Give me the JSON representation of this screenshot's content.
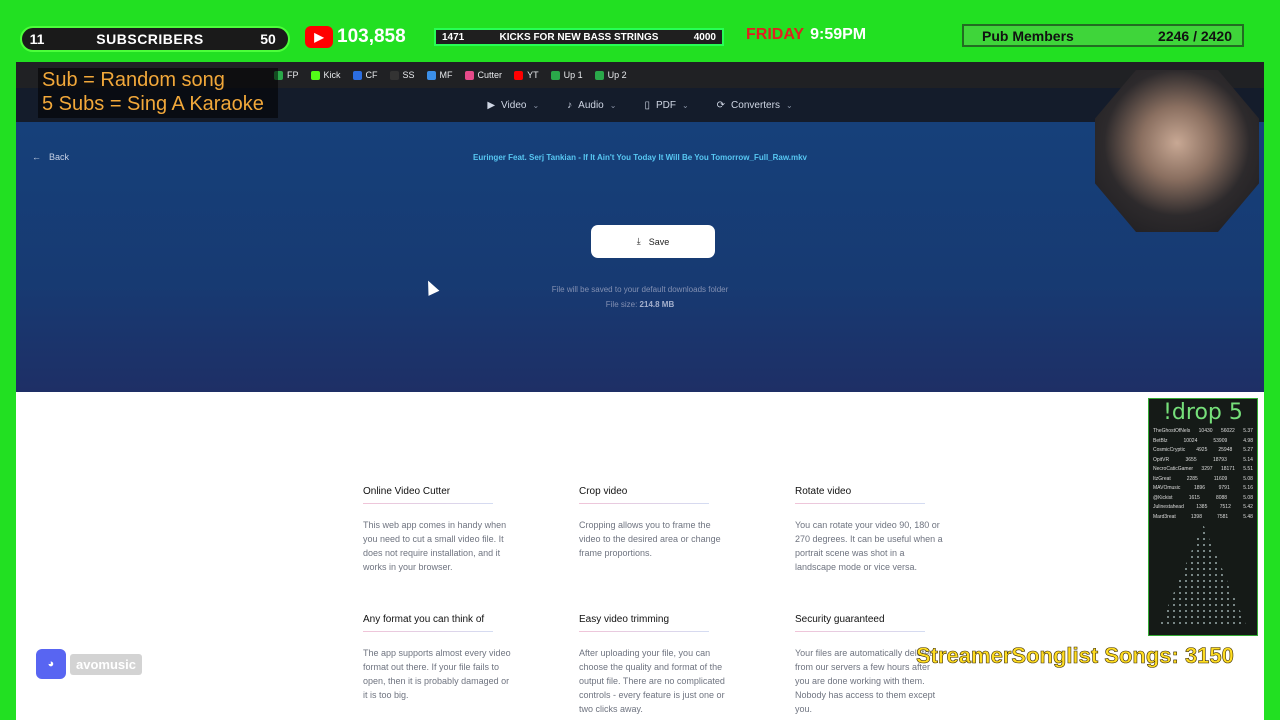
{
  "overlay": {
    "sub_count_left": "11",
    "sub_label": "SUBSCRIBERS",
    "sub_count_right": "50",
    "yt_count": "103,858",
    "kicks_left": "1471",
    "kicks_label": "KICKS FOR NEW BASS STRINGS",
    "kicks_right": "4000",
    "clock_day": "FRIDAY",
    "clock_time": "9:59PM",
    "pub_label": "Pub Members",
    "pub_value": "2246 / 2420",
    "tagline_1": "Sub = Random song",
    "tagline_2": "5 Subs = Sing A Karaoke",
    "drop_title": "!drop 5",
    "drop_rows": [
      [
        "TheGhostOfNels",
        "10430",
        "56022",
        "5.37"
      ],
      [
        "BetBlz",
        "10024",
        "53909",
        "4.98"
      ],
      [
        "CosmicCryptic",
        "4925",
        "25948",
        "5.27"
      ],
      [
        "OpitVR",
        "3655",
        "18793",
        "5.14"
      ],
      [
        "NecroCaticGamer",
        "3297",
        "18171",
        "5.51"
      ],
      [
        "ItzGreat",
        "2285",
        "11609",
        "5.08"
      ],
      [
        "MAVOmusic",
        "1896",
        "9791",
        "5.16"
      ],
      [
        "@Kickist",
        "1615",
        "8088",
        "5.08"
      ],
      [
        "Julinestahead",
        "1385",
        "7512",
        "5.42"
      ],
      [
        "Mard3reat",
        "1398",
        "7581",
        "5.48"
      ]
    ],
    "songlist": "StreamerSonglist Songs: 3150",
    "discord_name": "avomusic"
  },
  "bookmarks": [
    "FP",
    "Kick",
    "CF",
    "SS",
    "MF",
    "Cutter",
    "YT",
    "Up 1",
    "Up 2"
  ],
  "nav": {
    "items": [
      "Video",
      "Audio",
      "PDF",
      "Converters"
    ]
  },
  "hero": {
    "back_label": "Back",
    "filename": "Euringer Feat. Serj Tankian - If It Ain't You Today It Will Be You Tomorrow_Full_Raw.mkv",
    "save_label": "Save",
    "save_note": "File will be saved to your default downloads folder",
    "filesize_label": "File size:",
    "filesize_value": "214.8 MB"
  },
  "features": [
    {
      "title": "Online Video Cutter",
      "text": "This web app comes in handy when you need to cut a small video file. It does not require installation, and it works in your browser."
    },
    {
      "title": "Crop video",
      "text": "Cropping allows you to frame the video to the desired area or change frame proportions."
    },
    {
      "title": "Rotate video",
      "text": "You can rotate your video 90, 180 or 270 degrees. It can be useful when a portrait scene was shot in a landscape mode or vice versa."
    },
    {
      "title": "Any format you can think of",
      "text": "The app supports almost every video format out there. If your file fails to open, then it is probably damaged or it is too big."
    },
    {
      "title": "Easy video trimming",
      "text": "After uploading your file, you can choose the quality and format of the output file. There are no complicated controls - every feature is just one or two clicks away."
    },
    {
      "title": "Security guaranteed",
      "text": "Your files are automatically deleted from our servers a few hours after you are done working with them. Nobody has access to them except you."
    }
  ]
}
